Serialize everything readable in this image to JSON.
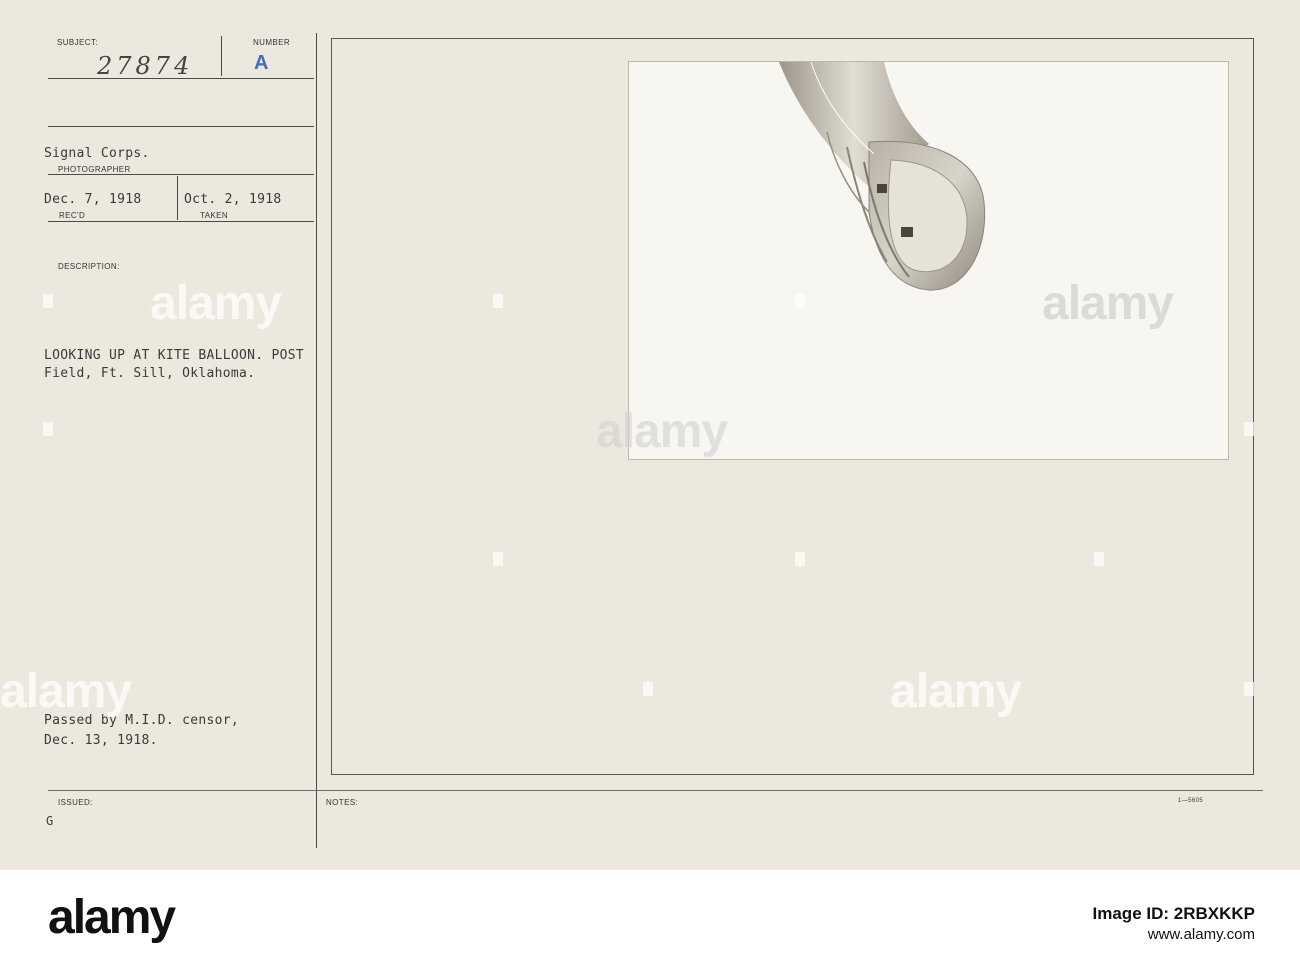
{
  "card": {
    "subject_label": "SUBJECT:",
    "subject_value": "27874",
    "number_label": "NUMBER",
    "number_value": "A",
    "photographer_value": "Signal Corps.",
    "photographer_label": "PHOTOGRAPHER",
    "received_value": "Dec. 7, 1918",
    "received_label": "REC'D",
    "taken_value": "Oct. 2, 1918",
    "taken_label": "TAKEN",
    "description_label": "DESCRIPTION:",
    "description_line1": "LOOKING UP AT KITE BALLOON. POST",
    "description_line2": "Field, Ft. Sill, Oklahoma.",
    "censor_line1": "Passed by M.I.D. censor,",
    "censor_line2": "Dec. 13, 1918.",
    "issued_label": "ISSUED:",
    "issued_value": "G",
    "notes_label": "NOTES:",
    "form_code": "1—5605"
  },
  "watermark": {
    "text": "alamy"
  },
  "footer": {
    "logo": "alamy",
    "image_id": "Image ID: 2RBXKKP",
    "site": "www.alamy.com"
  },
  "colors": {
    "card_background": "#ece8de",
    "stamp_blue": "#3f6fb8",
    "photo_background": "#f8f6f1"
  },
  "icons": [
    "kite-balloon-photo"
  ]
}
